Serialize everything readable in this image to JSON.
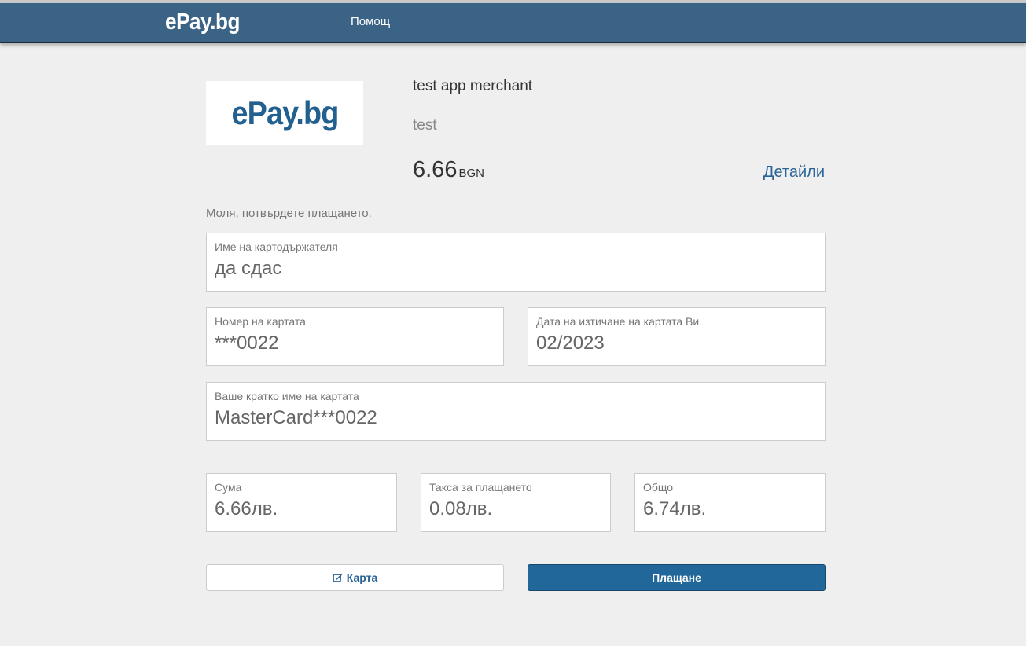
{
  "navbar": {
    "brand": "ePay.bg",
    "help_label": "Помощ"
  },
  "merchant": {
    "logo_text": "ePay.bg",
    "name": "test app merchant",
    "description": "test",
    "amount": "6.66",
    "currency": "BGN",
    "details_label": "Детайли"
  },
  "form": {
    "confirm_text": "Моля, потвърдете плащането.",
    "cardholder": {
      "label": "Име на картодържателя",
      "value": "да сдас"
    },
    "card_number": {
      "label": "Номер на картата",
      "value": "***0022"
    },
    "expiry": {
      "label": "Дата на изтичане на картата Ви",
      "value": "02/2023"
    },
    "card_short_name": {
      "label": "Ваше кратко име на картата",
      "value": "MasterCard***0022"
    }
  },
  "totals": {
    "sum": {
      "label": "Сума",
      "value": "6.66лв."
    },
    "fee": {
      "label": "Такса за плащането",
      "value": "0.08лв."
    },
    "total": {
      "label": "Общо",
      "value": "6.74лв."
    }
  },
  "actions": {
    "card_label": "Карта",
    "card_icon": "edit-icon",
    "pay_label": "Плащане"
  }
}
